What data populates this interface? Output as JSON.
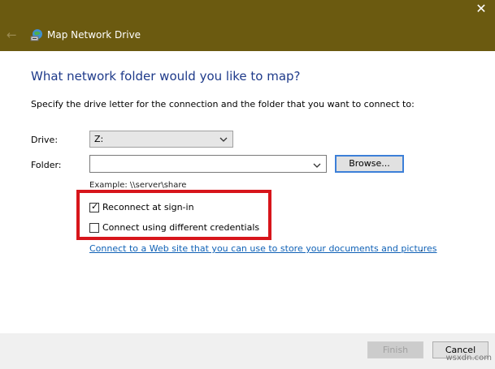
{
  "window": {
    "title": "Map Network Drive",
    "close_glyph": "✕",
    "back_glyph": "←",
    "titlebar_color": "#6b5a10"
  },
  "main": {
    "heading": "What network folder would you like to map?",
    "instructions": "Specify the drive letter for the connection and the folder that you want to connect to:",
    "drive": {
      "label": "Drive:",
      "value": "Z:"
    },
    "folder": {
      "label": "Folder:",
      "value": "",
      "browse_label": "Browse..."
    },
    "example": "Example: \\\\server\\share",
    "reconnect": {
      "label": "Reconnect at sign-in",
      "checked": true,
      "check_glyph": "✓"
    },
    "different_credentials": {
      "label": "Connect using different credentials",
      "checked": false
    },
    "web_link": {
      "text": "Connect to a Web site that you can use to store your documents and pictures",
      "period": "."
    }
  },
  "footer": {
    "finish_label": "Finish",
    "cancel_label": "Cancel"
  },
  "watermark": "wsxdn.com",
  "colors": {
    "heading": "#1e3a8a",
    "link": "#0f61b6",
    "highlight": "#d7151b",
    "focus": "#3c7fd8"
  }
}
